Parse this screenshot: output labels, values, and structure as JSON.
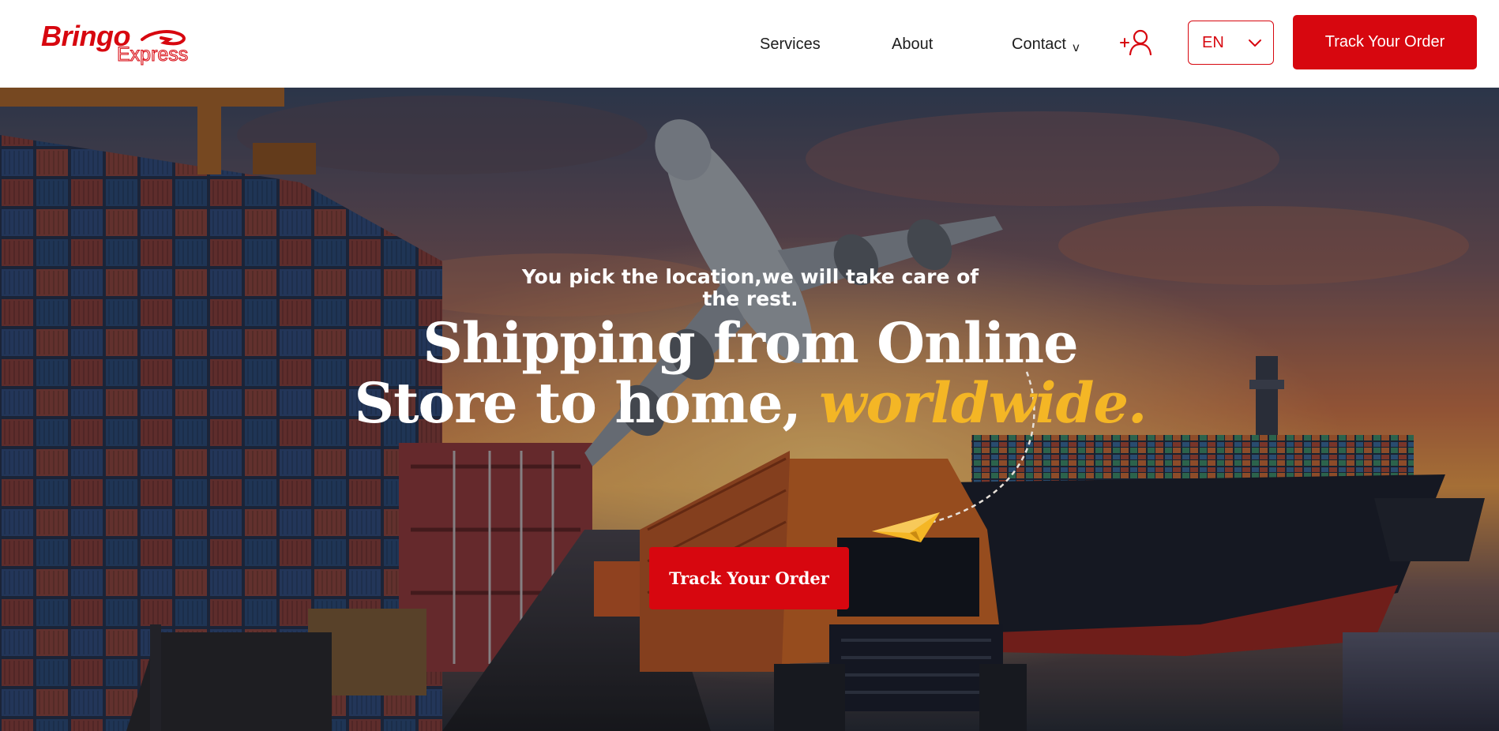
{
  "header": {
    "logo": {
      "primary": "Bringo",
      "secondary": "Express"
    },
    "nav": [
      {
        "label": "Services"
      },
      {
        "label": "About"
      },
      {
        "label": "Contact",
        "caret": "v"
      }
    ],
    "user_icon": "add-user-icon",
    "language": {
      "selected": "EN",
      "icon": "chevron-down-icon"
    },
    "cta_label": "Track Your Order"
  },
  "hero": {
    "tagline": "You pick the location,we will take care of the rest.",
    "heading_main": "Shipping from Online Store to home, ",
    "heading_accent": "worldwide.",
    "cta_label": "Track Your Order",
    "background": "airplane-truck-containers-ship-photo",
    "decoration_icon": "paper-plane-icon"
  },
  "colors": {
    "brand_red": "#d7070f",
    "accent_yellow": "#f4b625",
    "nav_text": "#1d1d1d",
    "white": "#ffffff"
  }
}
